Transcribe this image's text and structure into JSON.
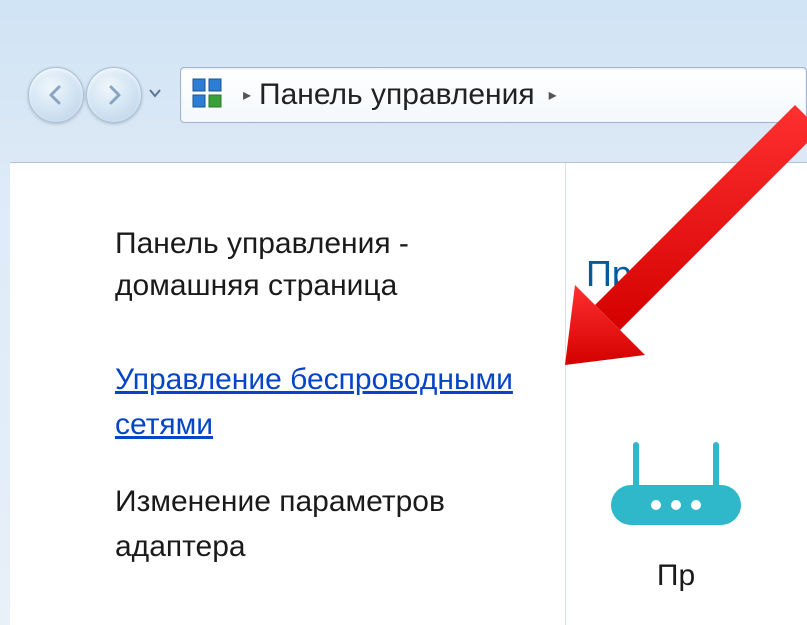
{
  "breadcrumb": {
    "root": "Панель управления"
  },
  "sidebar": {
    "heading": "Панель управления - домашняя страница",
    "wireless_link": "Управление беспроводными сетями",
    "adapter_settings": "Изменение параметров адаптера"
  },
  "main": {
    "heading_fragment": "Пр",
    "router_label_fragment": "Пр"
  }
}
